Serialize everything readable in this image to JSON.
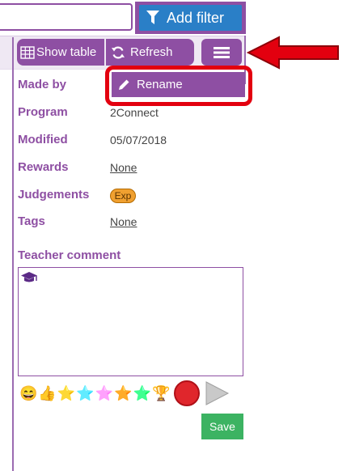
{
  "top": {
    "add_filter_label": "Add filter"
  },
  "toolbar": {
    "show_table_label": "Show table",
    "refresh_label": "Refresh"
  },
  "popup": {
    "rename_label": "Rename"
  },
  "details": {
    "made_by_label": "Made by",
    "program_label": "Program",
    "program_value": "2Connect",
    "modified_label": "Modified",
    "modified_value": "05/07/2018",
    "rewards_label": "Rewards",
    "rewards_value": "None",
    "judgements_label": "Judgements",
    "judgements_badge": "Exp",
    "tags_label": "Tags",
    "tags_value": "None"
  },
  "comment": {
    "label": "Teacher comment",
    "text": "",
    "emojis": [
      "😄",
      "👍",
      "⭐",
      "⭐",
      "⭐",
      "⭐",
      "⭐",
      "🏆"
    ]
  },
  "save_label": "Save",
  "colors": {
    "accent": "#8e4fa3",
    "filter_blue": "#2a7fc7",
    "highlight_red": "#e3000f",
    "save_green": "#3cb362",
    "badge_orange": "#f0a030"
  },
  "icons": [
    "filter-icon",
    "table-grid-icon",
    "refresh-icon",
    "hamburger-menu-icon",
    "pencil-icon",
    "graduation-cap-icon",
    "record-icon",
    "play-icon",
    "red-arrow-annotation"
  ]
}
